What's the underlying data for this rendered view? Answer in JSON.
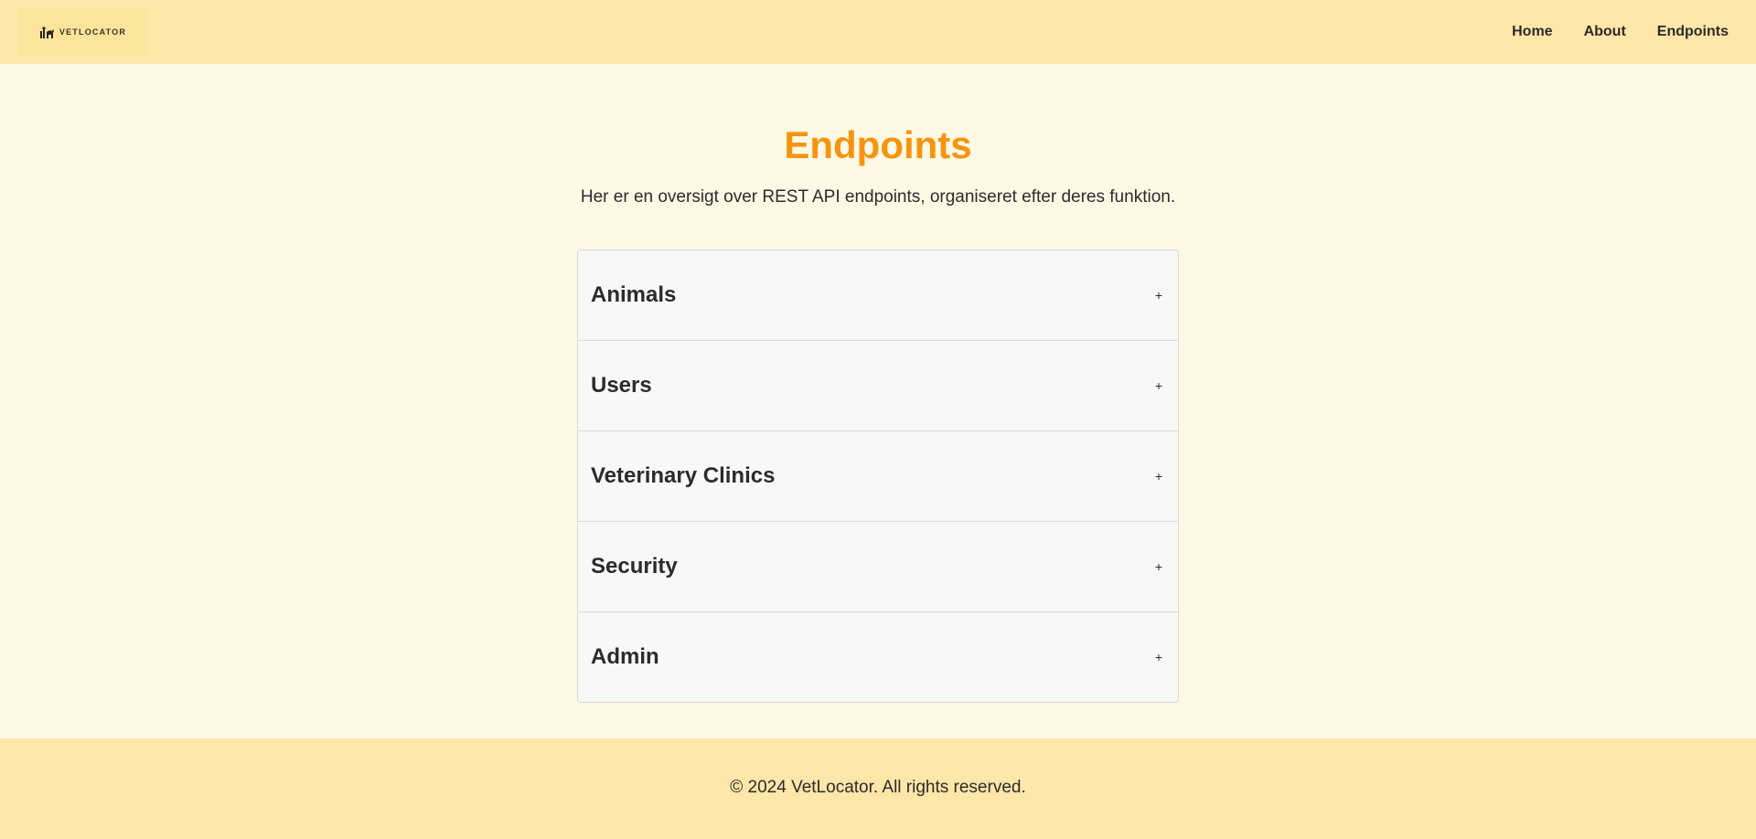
{
  "brand": {
    "logo_text": "VETLOCATOR",
    "logo_icon": "pets-silhouette-icon"
  },
  "nav": {
    "items": [
      {
        "label": "Home"
      },
      {
        "label": "About"
      },
      {
        "label": "Endpoints"
      }
    ]
  },
  "main": {
    "title": "Endpoints",
    "subtitle": "Her er en oversigt over REST API endpoints, organiseret efter deres funktion.",
    "sections": [
      {
        "label": "Animals",
        "toggle": "+"
      },
      {
        "label": "Users",
        "toggle": "+"
      },
      {
        "label": "Veterinary Clinics",
        "toggle": "+"
      },
      {
        "label": "Security",
        "toggle": "+"
      },
      {
        "label": "Admin",
        "toggle": "+"
      }
    ]
  },
  "footer": {
    "text": "© 2024 VetLocator. All rights reserved."
  },
  "colors": {
    "header_bg": "#ffe6a9",
    "page_bg": "#fff8e4",
    "accent": "#f6940f",
    "accordion_bg": "#f8f8f8"
  }
}
